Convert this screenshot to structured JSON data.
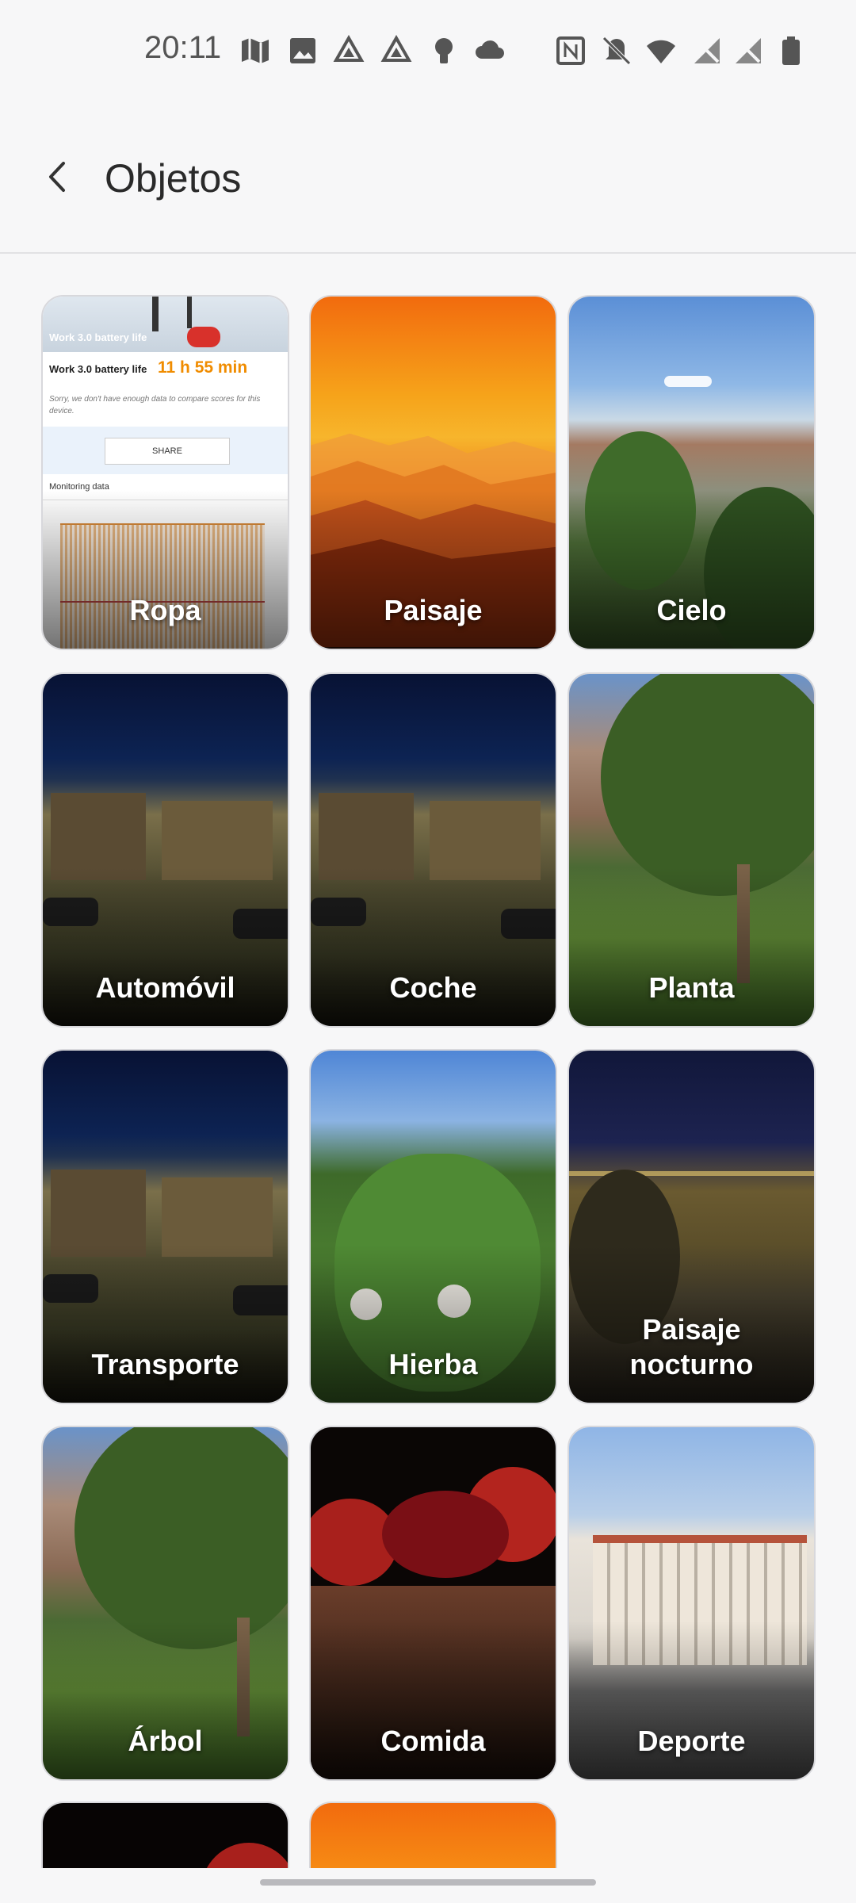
{
  "status_bar": {
    "time": "20:11",
    "left_icons": [
      "maps-icon",
      "image-icon",
      "drive-icon",
      "drive-icon",
      "bulb-icon",
      "cloud-icon"
    ],
    "right_icons": [
      "nfc-icon",
      "mute-icon",
      "wifi-icon",
      "no-signal-icon",
      "no-signal-icon",
      "battery-icon"
    ]
  },
  "header": {
    "title": "Objetos"
  },
  "categories": [
    {
      "label": "Ropa"
    },
    {
      "label": "Paisaje"
    },
    {
      "label": "Cielo"
    },
    {
      "label": "Automóvil"
    },
    {
      "label": "Coche"
    },
    {
      "label": "Planta"
    },
    {
      "label": "Transporte"
    },
    {
      "label": "Hierba"
    },
    {
      "label": "Paisaje\nnocturno"
    },
    {
      "label": "Árbol"
    },
    {
      "label": "Comida"
    },
    {
      "label": "Deporte"
    },
    {
      "label": ""
    },
    {
      "label": ""
    }
  ],
  "ropa_thumbnail": {
    "banner": "Work 3.0 battery life",
    "metric_label": "Work 3.0 battery life",
    "metric_value": "11 h 55 min",
    "note": "Sorry, we don't have enough data to compare scores for this device.",
    "share": "SHARE",
    "section": "Monitoring data"
  }
}
